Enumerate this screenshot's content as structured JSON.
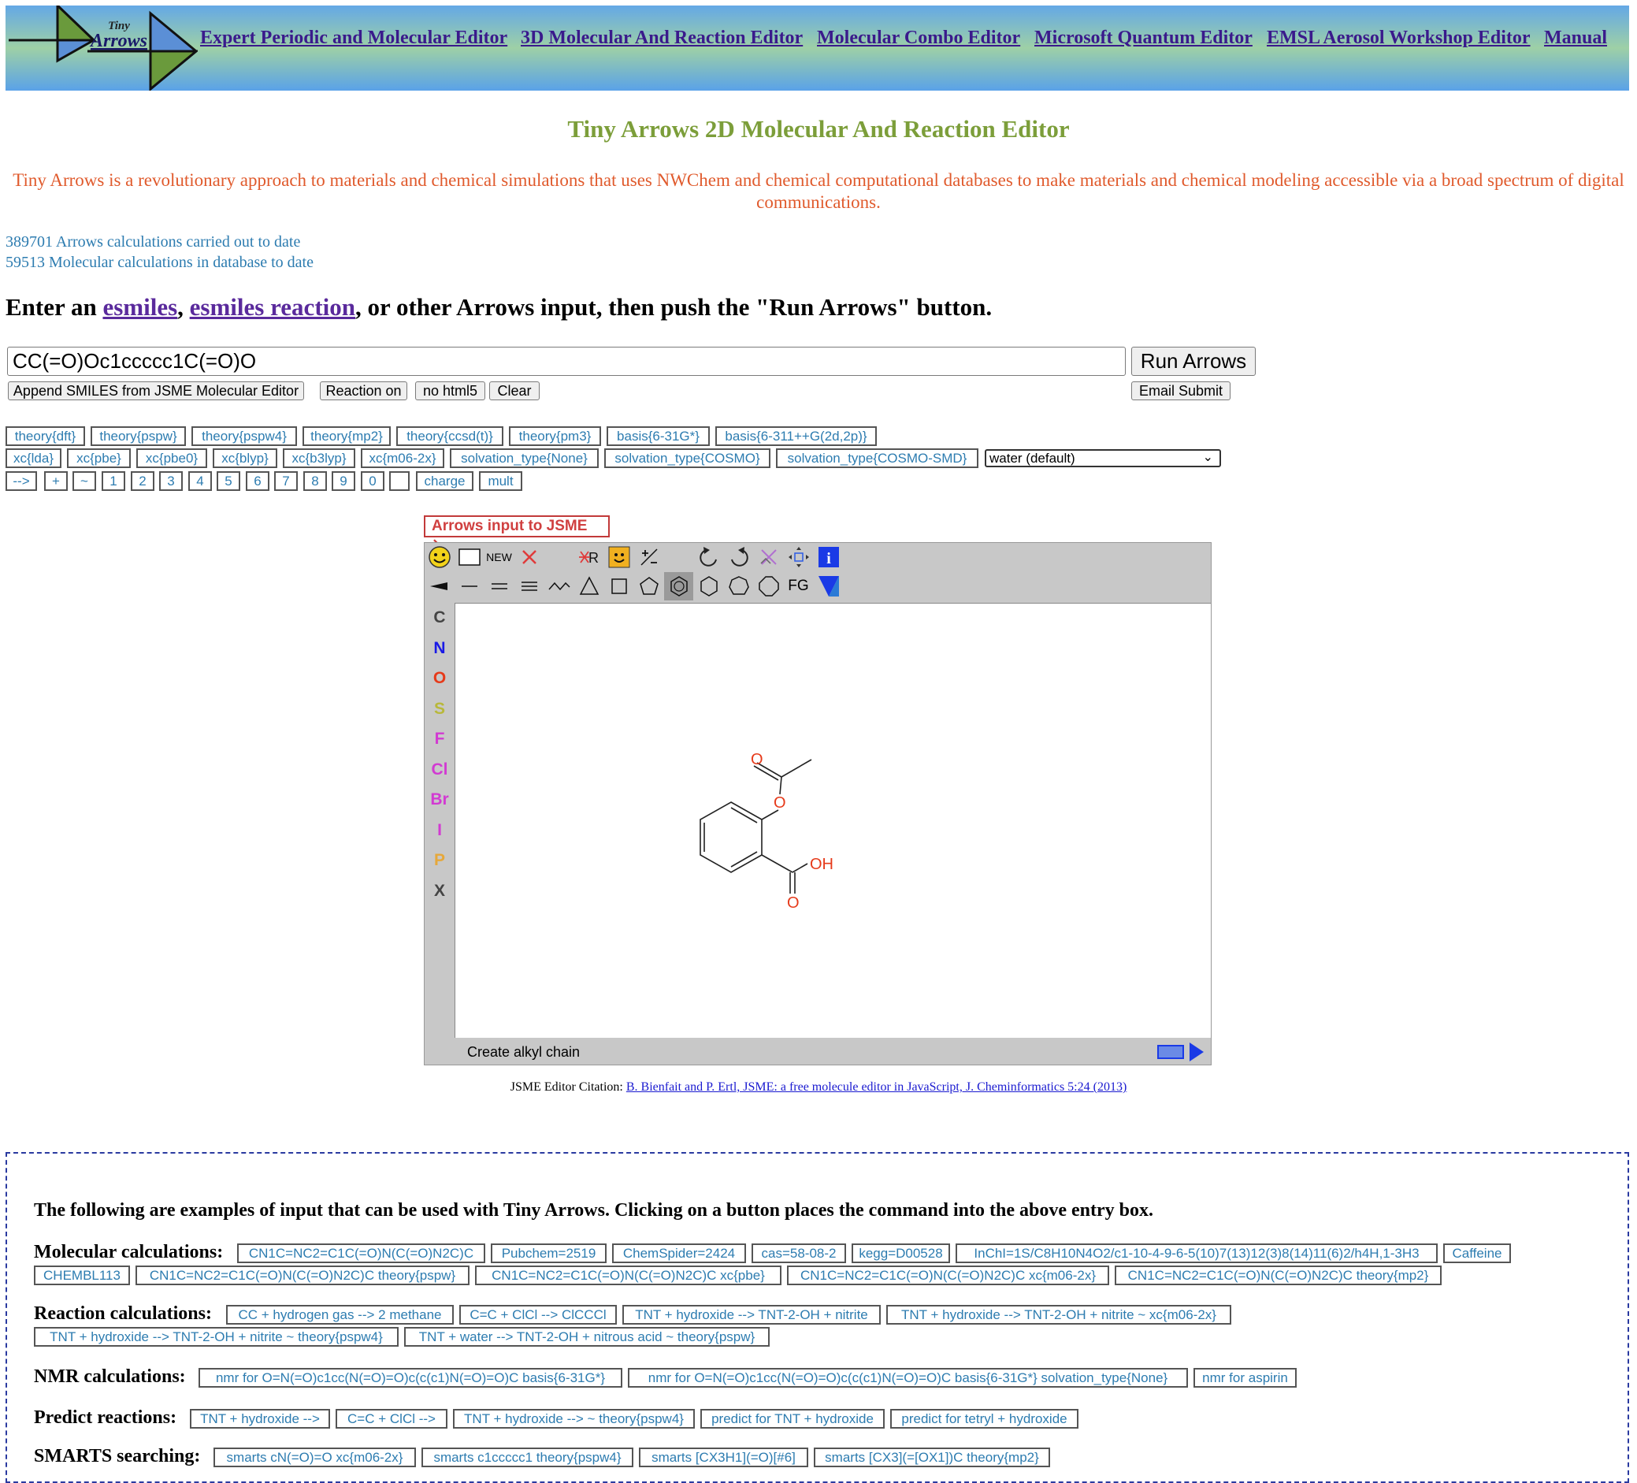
{
  "header": {
    "logo_text_small": "Tiny",
    "logo_text_big": "Arrows",
    "nav": [
      "Expert Periodic and Molecular Editor ",
      "3D Molecular And Reaction Editor",
      "Molecular Combo Editor",
      "Microsoft Quantum Editor",
      "EMSL Aerosol Workshop Editor",
      "Manual"
    ]
  },
  "title": "Tiny Arrows 2D Molecular And Reaction Editor",
  "intro": "Tiny Arrows is a revolutionary approach to materials and chemical simulations that uses NWChem and chemical computational databases to make materials and chemical modeling accessible via a broad spectrum of digital communications.",
  "stats": {
    "arrows_calcs": "389701 Arrows calculations carried out to date",
    "molecular_calcs": "59513 Molecular calculations in database to date"
  },
  "prompt": {
    "pre": "Enter an ",
    "link1": "esmiles",
    "sep": ", ",
    "link2": "esmiles reaction",
    "post": ", or other Arrows input, then push the \"Run Arrows\" button."
  },
  "entry_value": "CC(=O)Oc1ccccc1C(=O)O",
  "buttons": {
    "run": "Run Arrows",
    "append": "Append SMILES from JSME Molecular Editor",
    "reaction": "Reaction on",
    "nohtml": "no html5",
    "clear": "Clear",
    "email": "Email Submit"
  },
  "chips_row1": [
    "theory{dft}",
    "theory{pspw}",
    "theory{pspw4}",
    "theory{mp2}",
    "theory{ccsd(t)}",
    "theory{pm3}",
    "basis{6-31G*}",
    "basis{6-311++G(2d,2p)}"
  ],
  "chips_row2": [
    "xc{lda}",
    "xc{pbe}",
    "xc{pbe0}",
    "xc{blyp}",
    "xc{b3lyp}",
    "xc{m06-2x}",
    "solvation_type{None}",
    "solvation_type{COSMO}",
    "solvation_type{COSMO-SMD}"
  ],
  "solvent_selected": "water (default)",
  "chips_row3": [
    "-->",
    "+",
    "~",
    "1",
    "2",
    "3",
    "4",
    "5",
    "6",
    "7",
    "8",
    "9",
    "0",
    "",
    "charge",
    "mult"
  ],
  "jsme": {
    "open_button": "Arrows input to JSME ↘",
    "new_label": "NEW",
    "fg_label": "FG",
    "elements": [
      "C",
      "N",
      "O",
      "S",
      "F",
      "Cl",
      "Br",
      "I",
      "P",
      "X"
    ],
    "atoms": {
      "o_carbonyl": "O",
      "o_ester": "O",
      "oh": "OH",
      "o_acid": "O"
    },
    "status": "Create alkyl chain",
    "colors": {
      "C": "#444444",
      "N": "#1a1ae6",
      "O": "#e63a1a",
      "S": "#b8b83a",
      "F": "#d23ad2",
      "Cl": "#d23ad2",
      "Br": "#d23ad2",
      "I": "#d23ad2",
      "P": "#e6a83a",
      "X": "#444444"
    }
  },
  "citation": {
    "label": "JSME Editor Citation: ",
    "link": "B. Bienfait and P. Ertl, JSME: a free molecule editor in JavaScript, J. Cheminformatics 5:24 (2013)"
  },
  "examples": {
    "title": "The following are examples of input that can be used with Tiny Arrows. Clicking on a button places the command into the above entry box.",
    "molecular": {
      "label": "Molecular calculations:",
      "row1": [
        "CN1C=NC2=C1C(=O)N(C(=O)N2C)C",
        "Pubchem=2519",
        "ChemSpider=2424",
        "cas=58-08-2",
        "kegg=D00528",
        "InChI=1S/C8H10N4O2/c1-10-4-9-6-5(10)7(13)12(3)8(14)11(6)2/h4H,1-3H3",
        "Caffeine"
      ],
      "row2": [
        "CHEMBL113",
        "CN1C=NC2=C1C(=O)N(C(=O)N2C)C theory{pspw}",
        "CN1C=NC2=C1C(=O)N(C(=O)N2C)C xc{pbe}",
        "CN1C=NC2=C1C(=O)N(C(=O)N2C)C xc{m06-2x}",
        "CN1C=NC2=C1C(=O)N(C(=O)N2C)C theory{mp2}"
      ]
    },
    "reaction": {
      "label": "Reaction calculations:",
      "row1": [
        "CC + hydrogen gas --> 2 methane",
        "C=C + ClCl --> ClCCCl",
        "TNT + hydroxide --> TNT-2-OH + nitrite",
        "TNT + hydroxide --> TNT-2-OH + nitrite ~ xc{m06-2x}"
      ],
      "row2": [
        "TNT + hydroxide --> TNT-2-OH + nitrite ~ theory{pspw4}",
        "TNT + water --> TNT-2-OH + nitrous acid ~ theory{pspw}"
      ]
    },
    "nmr": {
      "label": "NMR calculations:",
      "row1": [
        "nmr for O=N(=O)c1cc(N(=O)=O)c(c(c1)N(=O)=O)C basis{6-31G*}",
        "nmr for O=N(=O)c1cc(N(=O)=O)c(c(c1)N(=O)=O)C basis{6-31G*} solvation_type{None}",
        "nmr for aspirin"
      ]
    },
    "predict": {
      "label": "Predict reactions:",
      "row1": [
        "TNT + hydroxide -->",
        "C=C + ClCl -->",
        "TNT + hydroxide --> ~ theory{pspw4}",
        "predict for TNT + hydroxide",
        "predict for tetryl + hydroxide"
      ]
    },
    "smarts": {
      "label": "SMARTS searching:",
      "row1": [
        "smarts cN(=O)=O  xc{m06-2x}",
        "smarts c1ccccc1 theory{pspw4}",
        "smarts [CX3H1](=O)[#6]",
        "smarts [CX3](=[OX1])C theory{mp2}"
      ]
    }
  }
}
